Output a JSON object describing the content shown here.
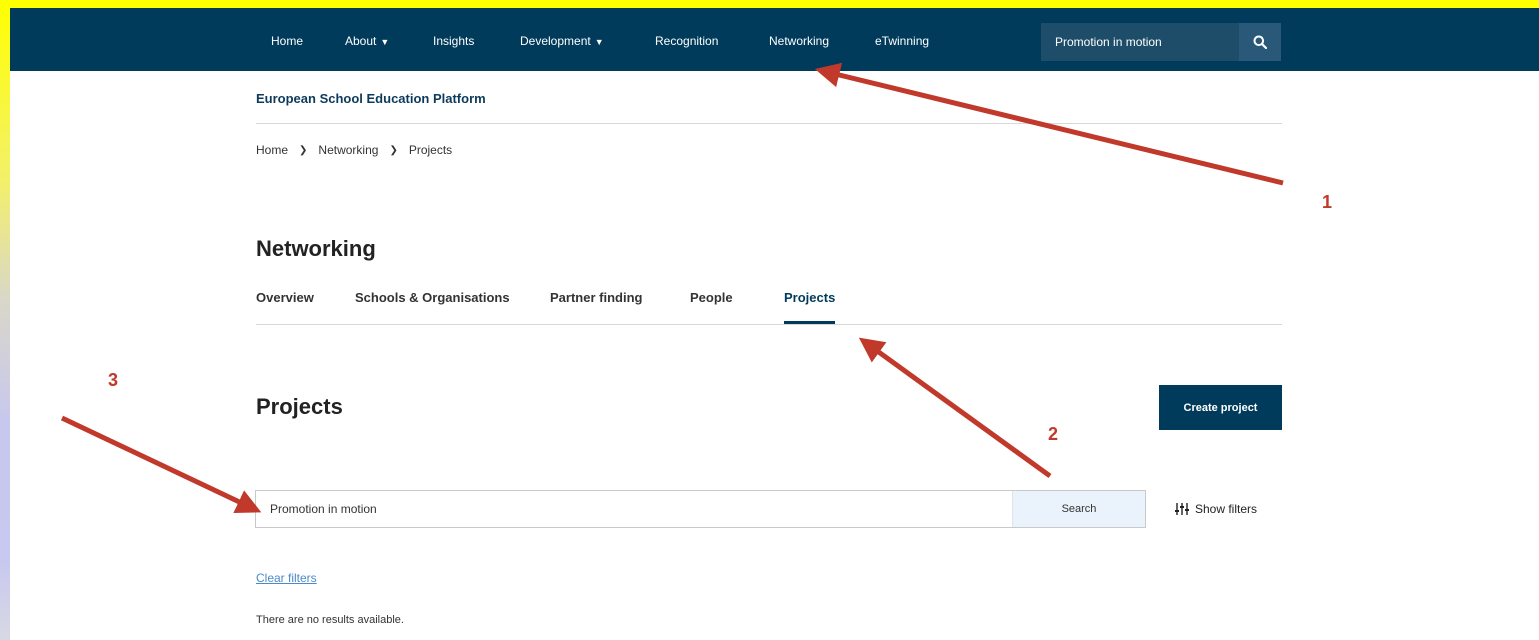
{
  "nav": {
    "items": [
      {
        "label": "Home",
        "dropdown": false
      },
      {
        "label": "About",
        "dropdown": true
      },
      {
        "label": "Insights",
        "dropdown": false
      },
      {
        "label": "Development",
        "dropdown": true
      },
      {
        "label": "Recognition",
        "dropdown": false
      },
      {
        "label": "Networking",
        "dropdown": false
      },
      {
        "label": "eTwinning",
        "dropdown": false
      }
    ],
    "search_value": "Promotion in motion",
    "search_icon": "search-icon"
  },
  "site_title": "European School Education Platform",
  "breadcrumb": [
    "Home",
    "Networking",
    "Projects"
  ],
  "section_title": "Networking",
  "tabs": [
    {
      "label": "Overview",
      "active": false
    },
    {
      "label": "Schools & Organisations",
      "active": false
    },
    {
      "label": "Partner finding",
      "active": false
    },
    {
      "label": "People",
      "active": false
    },
    {
      "label": "Projects",
      "active": true
    }
  ],
  "projects": {
    "title": "Projects",
    "create_label": "Create project",
    "search_value": "Promotion in motion",
    "search_button": "Search",
    "show_filters": "Show filters",
    "clear_filters": "Clear filters",
    "no_results": "There are no results available."
  },
  "annotations": [
    "1",
    "2",
    "3"
  ],
  "colors": {
    "navbar": "#003b5c",
    "accent": "#003b5c",
    "arrow": "#c0392b",
    "frame": "#ffff00"
  }
}
